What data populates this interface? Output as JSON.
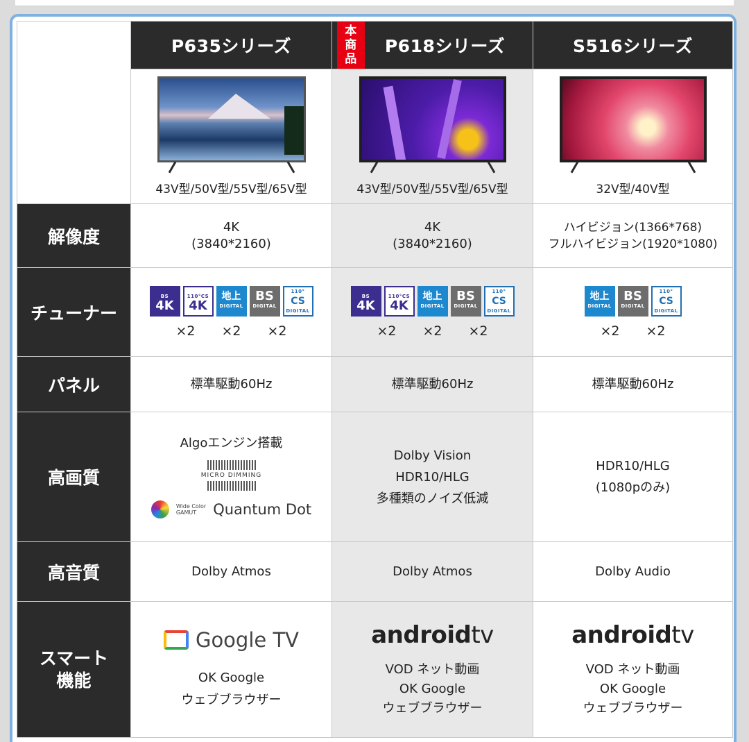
{
  "columns": [
    {
      "name": "P635シリーズ",
      "badge": null,
      "sizes": "43V型/50V型/55V型/65V型"
    },
    {
      "name": "P618シリーズ",
      "badge": [
        "本",
        "商",
        "品"
      ],
      "sizes": "43V型/50V型/55V型/65V型"
    },
    {
      "name": "S516シリーズ",
      "badge": null,
      "sizes": "32V型/40V型"
    }
  ],
  "rows": {
    "resolution": {
      "label": "解像度",
      "values": [
        [
          "4K",
          "(3840*2160)"
        ],
        [
          "4K",
          "(3840*2160)"
        ],
        [
          "ハイビジョン(1366*768)",
          "フルハイビジョン(1920*1080)"
        ]
      ]
    },
    "tuner": {
      "label": "チューナー",
      "logo_text": {
        "bs4k_top": "BS",
        "bs4k_bottom": "4K",
        "cs4k_top": "110°CS",
        "cs4k_bottom": "4K",
        "chi_top": "地上",
        "chi_bottom": "DIGITAL",
        "bs_top": "BS",
        "bs_bottom": "DIGITAL",
        "cs_top": "110°",
        "cs_mid": "CS",
        "cs_bottom": "DIGITAL"
      },
      "multipliers_4k": [
        "×2",
        "×2",
        "×2"
      ],
      "multipliers_2k": [
        "×2",
        "×2"
      ]
    },
    "panel": {
      "label": "パネル",
      "values": [
        "標準駆動60Hz",
        "標準駆動60Hz",
        "標準駆動60Hz"
      ]
    },
    "picture": {
      "label": "高画質",
      "p635": {
        "engine": "Algoエンジン搭載",
        "micro_dimming": "MICRO DIMMING",
        "gamut_line1": "Wide Color",
        "gamut_line2": "GAMUT",
        "quantum": "Quantum Dot"
      },
      "p618": [
        "Dolby Vision",
        "HDR10/HLG",
        "多種類のノイズ低減"
      ],
      "s516": [
        "HDR10/HLG",
        "(1080pのみ)"
      ]
    },
    "sound": {
      "label": "高音質",
      "values": [
        "Dolby Atmos",
        "Dolby Atmos",
        "Dolby Audio"
      ]
    },
    "smart": {
      "label_line1": "スマート",
      "label_line2": "機能",
      "p635": {
        "platform": "Google TV",
        "features": [
          "OK Google",
          "ウェブブラウザー"
        ]
      },
      "p618": {
        "platform_bold": "android",
        "platform_light": "tv",
        "features": [
          "VOD ネット動画",
          "OK Google",
          "ウェブブラウザー"
        ]
      },
      "s516": {
        "platform_bold": "android",
        "platform_light": "tv",
        "features": [
          "VOD ネット動画",
          "OK Google",
          "ウェブブラウザー"
        ]
      }
    }
  },
  "colors": {
    "header_bg": "#2b2b2b",
    "badge_red": "#e60012",
    "highlight_column": "#e8e8e8",
    "frame_blue": "#7fb1e0"
  }
}
